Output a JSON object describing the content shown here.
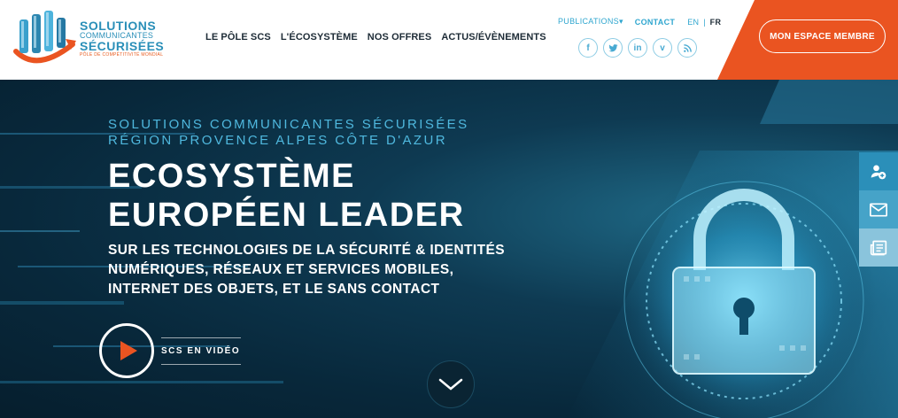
{
  "logo": {
    "line1": "SOLUTIONS",
    "line2": "COMMUNICANTES",
    "line3": "SÉCURISÉES",
    "tagline": "PÔLE DE COMPÉTITIVITÉ MONDIAL"
  },
  "main_nav": [
    {
      "label": "LE PÔLE SCS"
    },
    {
      "label": "L'ÉCOSYSTÈME"
    },
    {
      "label": "NOS OFFRES"
    },
    {
      "label": "ACTUS/ÉVÈNEMENTS"
    }
  ],
  "top_nav": {
    "publications": "PUBLICATIONS",
    "publications_caret": "▾",
    "contact": "CONTACT",
    "lang_en": "EN",
    "lang_sep": "|",
    "lang_fr": "FR"
  },
  "socials": [
    {
      "icon": "facebook-icon",
      "glyph": "f"
    },
    {
      "icon": "twitter-icon",
      "glyph": ""
    },
    {
      "icon": "linkedin-icon",
      "glyph": "in"
    },
    {
      "icon": "vimeo-icon",
      "glyph": "v"
    },
    {
      "icon": "rss-icon",
      "glyph": ""
    }
  ],
  "member_button": "MON ESPACE MEMBRE",
  "hero": {
    "kicker_line1": "SOLUTIONS COMMUNICANTES SÉCURISÉES",
    "kicker_line2": "RÉGION PROVENCE ALPES CÔTE D'AZUR",
    "headline_line1": "ECOSYSTÈME",
    "headline_line2": "EUROPÉEN LEADER",
    "sub_line1": "SUR LES TECHNOLOGIES DE LA SÉCURITÉ & IDENTITÉS",
    "sub_line2": "NUMÉRIQUES, RÉSEAUX ET SERVICES MOBILES,",
    "sub_line3": "INTERNET DES OBJETS, ET LE SANS CONTACT",
    "video_label": "SCS EN VIDÉO"
  },
  "side_tools": [
    {
      "icon": "add-user-icon"
    },
    {
      "icon": "mail-icon"
    },
    {
      "icon": "newsletter-icon"
    }
  ],
  "colors": {
    "accent_orange": "#ea5421",
    "brand_blue": "#2fa6cf",
    "nav_dark": "#1d2b36"
  }
}
